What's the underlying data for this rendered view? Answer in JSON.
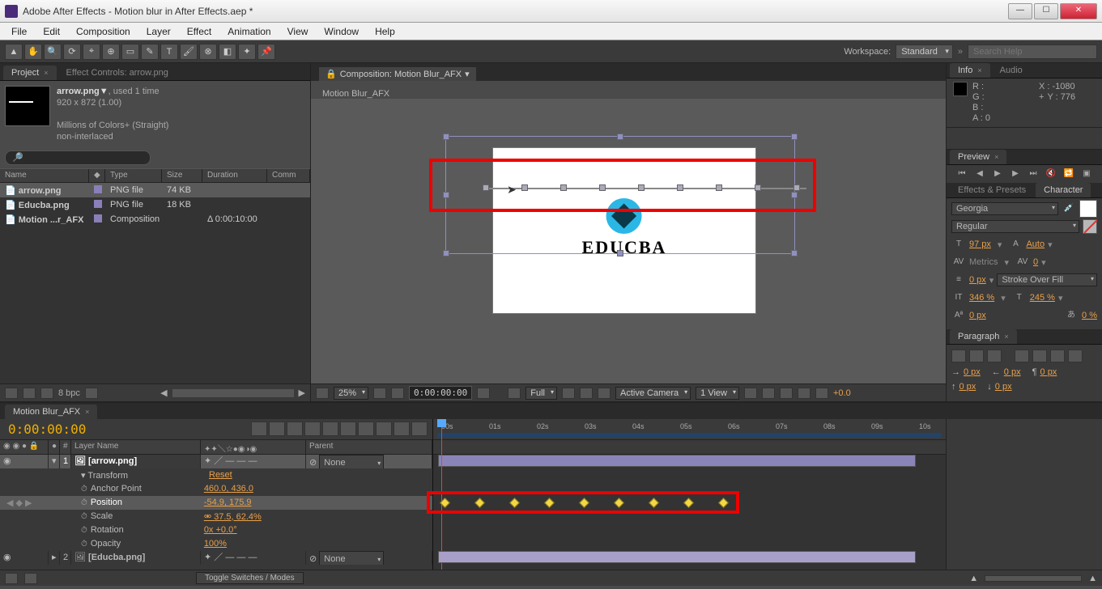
{
  "titlebar": {
    "title": "Adobe After Effects - Motion blur in After Effects.aep *"
  },
  "menu": [
    "File",
    "Edit",
    "Composition",
    "Layer",
    "Effect",
    "Animation",
    "View",
    "Window",
    "Help"
  ],
  "workspace": {
    "label": "Workspace:",
    "value": "Standard"
  },
  "search_help_placeholder": "Search Help",
  "project": {
    "tab": "Project",
    "tab2": "Effect Controls: arrow.png",
    "item_name": "arrow.png▼",
    "item_used": ", used 1 time",
    "item_dim": "920 x 872 (1.00)",
    "item_colors": "Millions of Colors+ (Straight)",
    "item_interlace": "non-interlaced",
    "cols": {
      "name": "Name",
      "type": "Type",
      "size": "Size",
      "duration": "Duration",
      "comm": "Comm"
    },
    "rows": [
      {
        "name": "arrow.png",
        "type": "PNG file",
        "size": "74 KB",
        "duration": "",
        "sel": true
      },
      {
        "name": "Educba.png",
        "type": "PNG file",
        "size": "18 KB",
        "duration": "",
        "sel": false
      },
      {
        "name": "Motion ...r_AFX",
        "type": "Composition",
        "size": "",
        "duration": "Δ 0:00:10:00",
        "sel": false
      }
    ],
    "footer_bpc": "8 bpc"
  },
  "comp": {
    "tab_prefix": "Composition: Motion Blur_AFX",
    "inner_tab": "Motion Blur_AFX",
    "logo_text": "EDUCBA",
    "viewer": {
      "zoom": "25%",
      "timecode": "0:00:00:00",
      "quality": "Full",
      "camera": "Active Camera",
      "views": "1 View",
      "exposure": "+0.0"
    }
  },
  "info": {
    "tab": "Info",
    "tab2": "Audio",
    "r": "R :",
    "g": "G :",
    "b": "B :",
    "a": "A : 0",
    "x": "X : -1080",
    "y": "Y : 776"
  },
  "preview": {
    "tab": "Preview"
  },
  "effects_presets": {
    "tab": "Effects & Presets",
    "tab2": "Character"
  },
  "character": {
    "font": "Georgia",
    "style": "Regular",
    "size": "97 px",
    "leading": "Auto",
    "kerning": "Metrics",
    "tracking": "0",
    "stroke_w": "0 px",
    "stroke_opt": "Stroke Over Fill",
    "vscale": "346 %",
    "hscale": "245 %",
    "baseline": "0 px",
    "tsume": "0 %"
  },
  "paragraph": {
    "tab": "Paragraph",
    "indent_left": "0 px",
    "indent_right": "0 px",
    "indent_first": "0 px",
    "space_before": "0 px",
    "space_after": "0 px"
  },
  "timeline": {
    "tab": "Motion Blur_AFX",
    "timecode": "0:00:00:00",
    "cols": {
      "layer_name": "Layer Name",
      "parent": "Parent",
      "num": "#"
    },
    "layers": [
      {
        "num": "1",
        "name": "[arrow.png]",
        "parent": "None",
        "sel": true
      },
      {
        "num": "2",
        "name": "[Educba.png]",
        "parent": "None",
        "sel": false
      }
    ],
    "transform": "Transform",
    "reset": "Reset",
    "props": {
      "anchor": {
        "label": "Anchor Point",
        "val": "460.0, 436.0"
      },
      "position": {
        "label": "Position",
        "val": "-54.9, 175.9"
      },
      "scale": {
        "label": "Scale",
        "val": "37.5, 62.4%"
      },
      "rotation": {
        "label": "Rotation",
        "val": "0x +0.0°"
      },
      "opacity": {
        "label": "Opacity",
        "val": "100%"
      }
    },
    "ruler": [
      "00s",
      "01s",
      "02s",
      "03s",
      "04s",
      "05s",
      "06s",
      "07s",
      "08s",
      "09s",
      "10s"
    ],
    "toggle": "Toggle Switches / Modes"
  }
}
